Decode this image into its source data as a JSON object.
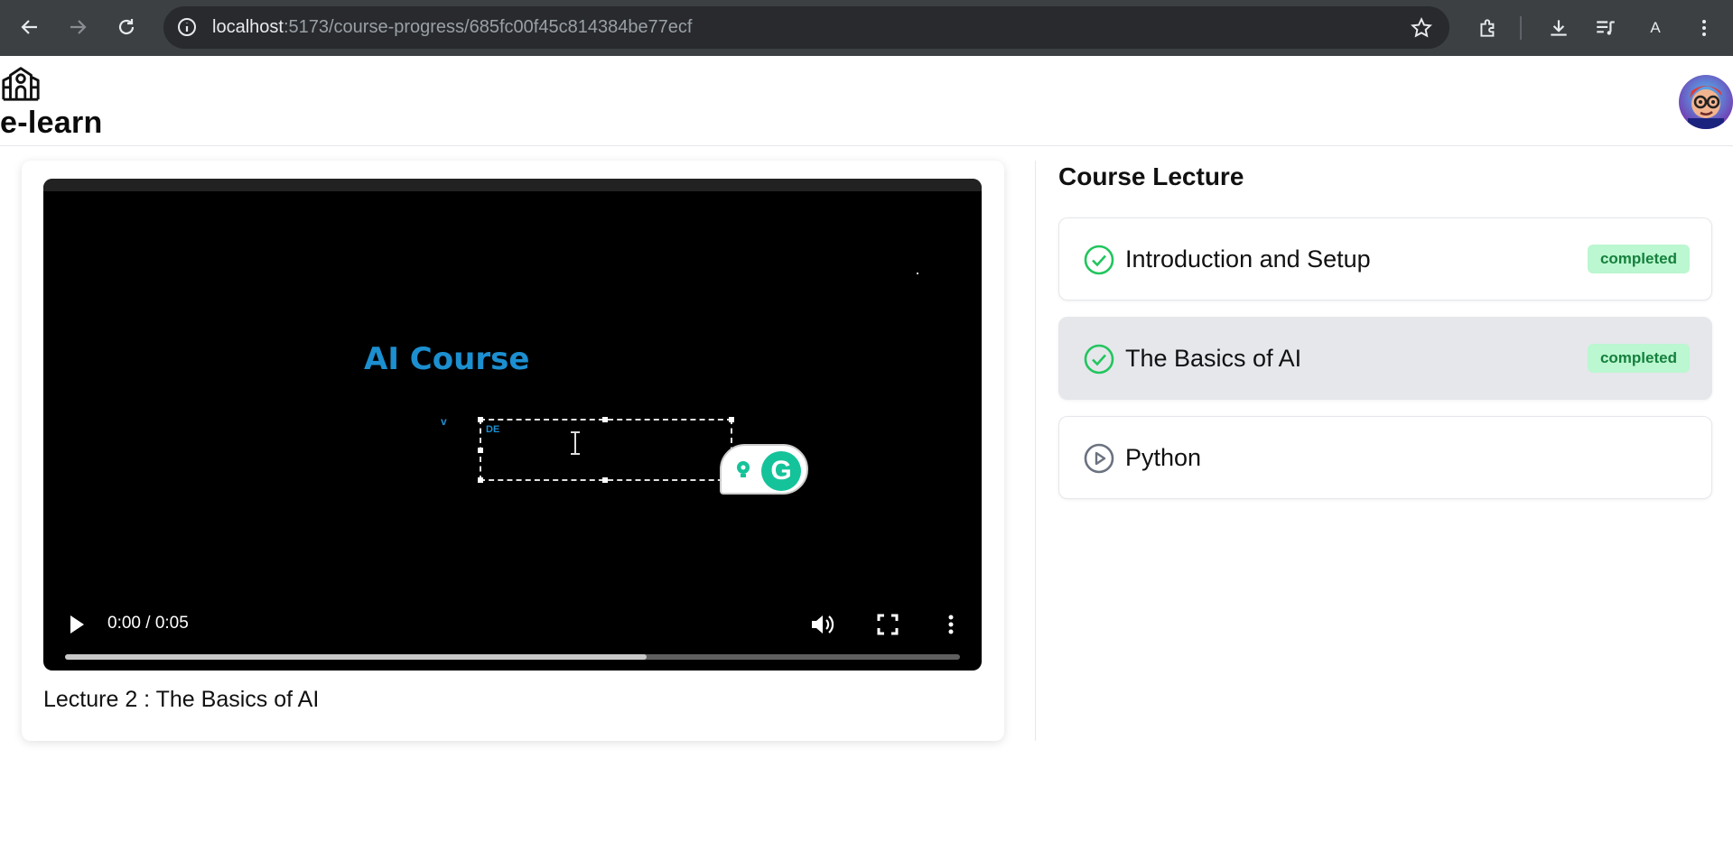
{
  "browser": {
    "url_host": "localhost",
    "url_path": ":5173/course-progress/685fc00f45c814384be77ecf",
    "profile_initial": "A"
  },
  "header": {
    "brand": "e-learn",
    "logo_icon": "school-icon"
  },
  "video": {
    "slide_title": "AI Course",
    "slide_small_mark": "v",
    "slide_box_text": "DE",
    "time": "0:00 / 0:05",
    "progress_fraction": 0.65
  },
  "lecture": {
    "current_title": "Lecture 2 : The Basics of AI"
  },
  "sidebar": {
    "title": "Course Lecture",
    "items": [
      {
        "label": "Introduction and Setup",
        "status": "completed",
        "icon": "check-circle-icon",
        "active": false
      },
      {
        "label": "The Basics of AI",
        "status": "completed",
        "icon": "check-circle-icon",
        "active": true
      },
      {
        "label": "Python",
        "status": "",
        "icon": "play-circle-icon",
        "active": false
      }
    ]
  },
  "colors": {
    "accent_green": "#22c55e",
    "badge_bg": "#bbf7d0",
    "badge_text": "#15803d",
    "slide_blue": "#1c8fd0"
  }
}
